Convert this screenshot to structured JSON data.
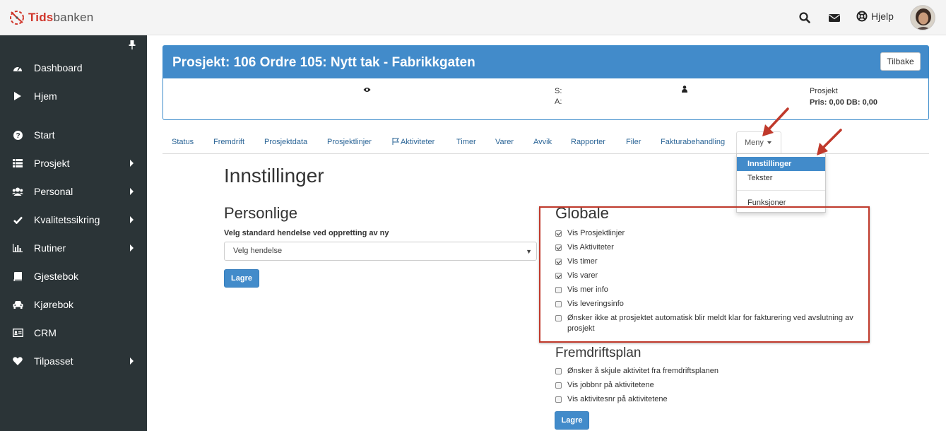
{
  "app": {
    "logo_brand": "Tids",
    "logo_rest": "banken",
    "help_label": "Hjelp"
  },
  "sidebar": {
    "items": [
      {
        "label": "Dashboard",
        "icon": "dashboard-icon",
        "submenu": false
      },
      {
        "label": "Hjem",
        "icon": "play-icon",
        "submenu": false
      },
      {
        "label": "Start",
        "icon": "question-icon",
        "submenu": false
      },
      {
        "label": "Prosjekt",
        "icon": "list-icon",
        "submenu": true
      },
      {
        "label": "Personal",
        "icon": "users-icon",
        "submenu": true
      },
      {
        "label": "Kvalitetssikring",
        "icon": "check-icon",
        "submenu": true
      },
      {
        "label": "Rutiner",
        "icon": "bar-chart-icon",
        "submenu": true
      },
      {
        "label": "Gjestebok",
        "icon": "book-icon",
        "submenu": false
      },
      {
        "label": "Kjørebok",
        "icon": "car-icon",
        "submenu": false
      },
      {
        "label": "CRM",
        "icon": "id-card-icon",
        "submenu": false
      },
      {
        "label": "Tilpasset",
        "icon": "heart-icon",
        "submenu": true
      }
    ]
  },
  "project": {
    "title": "Prosjekt: 106 Ordre 105: Nytt tak - Fabrikkgaten",
    "back_label": "Tilbake",
    "s_label": "S:",
    "a_label": "A:",
    "type_label": "Prosjekt",
    "price_line": "Pris: 0,00 DB: 0,00"
  },
  "tabs": {
    "items": [
      "Status",
      "Fremdrift",
      "Prosjektdata",
      "Prosjektlinjer",
      "Aktiviteter",
      "Timer",
      "Varer",
      "Avvik",
      "Rapporter",
      "Filer",
      "Fakturabehandling"
    ],
    "menu_label": "Meny"
  },
  "dropdown": {
    "items": [
      "Innstillinger",
      "Tekster",
      "Funksjoner"
    ],
    "active": "Innstillinger"
  },
  "settings": {
    "heading": "Innstillinger",
    "personal": {
      "heading": "Personlige",
      "field_label": "Velg standard hendelse ved oppretting av ny",
      "select_value": "Velg hendelse",
      "save_label": "Lagre"
    },
    "global": {
      "heading": "Globale",
      "options": [
        {
          "label": "Vis Prosjektlinjer",
          "checked": true
        },
        {
          "label": "Vis Aktiviteter",
          "checked": true
        },
        {
          "label": "Vis timer",
          "checked": true
        },
        {
          "label": "Vis varer",
          "checked": true
        },
        {
          "label": "Vis mer info",
          "checked": false
        },
        {
          "label": "Vis leveringsinfo",
          "checked": false
        },
        {
          "label": "Ønsker ikke at prosjektet automatisk blir meldt klar for fakturering ved avslutning av",
          "label_cont": "prosjekt",
          "checked": false
        }
      ]
    },
    "progress": {
      "heading": "Fremdriftsplan",
      "options": [
        {
          "label": "Ønsker å skjule aktivitet fra fremdriftsplanen",
          "checked": false
        },
        {
          "label": "Vis jobbnr på aktivitetene",
          "checked": false
        },
        {
          "label": "Vis aktivitesnr på aktivitetene",
          "checked": false
        }
      ],
      "save_label": "Lagre"
    }
  },
  "colors": {
    "sidebar_bg": "#2b3437",
    "primary": "#428bca",
    "highlight": "#c0392b",
    "brand_red": "#d0352a"
  }
}
